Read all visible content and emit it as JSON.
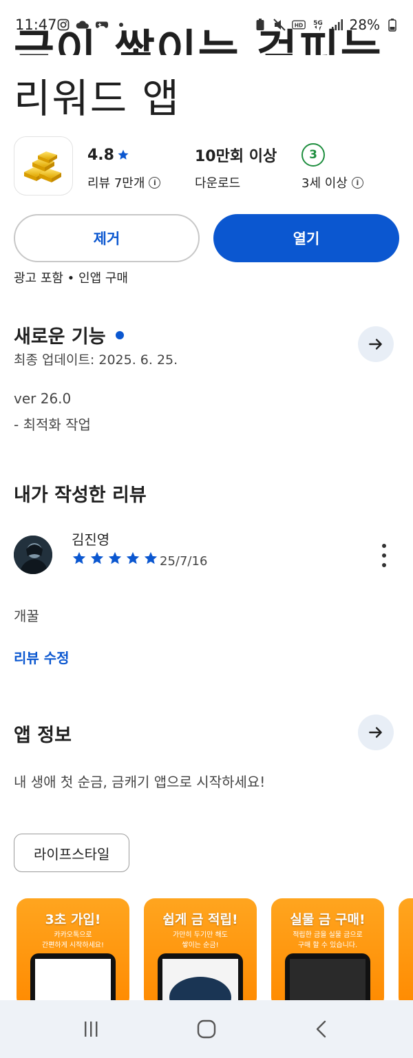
{
  "status_bar": {
    "time": "11:47",
    "battery": "28%"
  },
  "app": {
    "title_partial": "금이 쌓이는 걷피는",
    "title_line2": "리워드 앱",
    "icon": "gold-bars-icon"
  },
  "stats": {
    "rating": {
      "value": "4.8",
      "label": "리뷰 7만개"
    },
    "downloads": {
      "value": "10만회 이상",
      "label": "다운로드"
    },
    "age": {
      "badge": "3",
      "label": "3세 이상"
    }
  },
  "buttons": {
    "remove": "제거",
    "open": "열기"
  },
  "ads_note": "광고 포함 • 인앱 구매",
  "whats_new": {
    "title": "새로운 기능",
    "updated": "최종 업데이트: 2025. 6. 25.",
    "version": "ver 26.0",
    "notes": "- 최적화 작업"
  },
  "my_review": {
    "title": "내가 작성한 리뷰",
    "reviewer": "김진영",
    "stars": 5,
    "date": "25/7/16",
    "text": "개꿀",
    "edit_label": "리뷰 수정"
  },
  "app_info": {
    "title": "앱 정보",
    "description": "내 생애 첫 순금, 금캐기 앱으로 시작하세요!",
    "category": "라이프스타일"
  },
  "screenshots": [
    {
      "title": "3초 가입!",
      "line1": "카카오톡으로",
      "line2": "간편하게 시작하세요!"
    },
    {
      "title": "쉽게 금 적립!",
      "line1": "가만히 두기만 해도",
      "line2": "쌓이는 순금!"
    },
    {
      "title": "실물 금 구매!",
      "line1": "적립한 금을 실물 금으로",
      "line2": "구매 할 수 있습니다."
    }
  ],
  "colors": {
    "accent": "#0b57d0",
    "age_badge": "#1e8e3e",
    "screenshot_bg": "#ff9a10"
  }
}
